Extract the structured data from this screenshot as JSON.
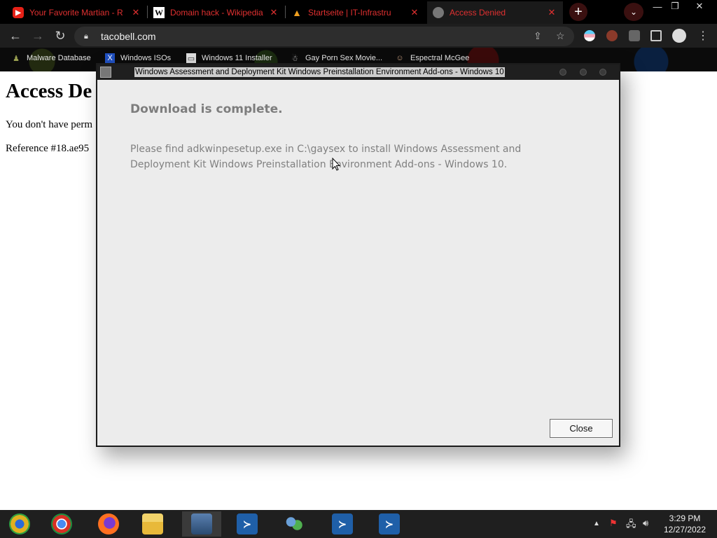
{
  "browser": {
    "tabs": [
      {
        "title": "Your Favorite Martian - R",
        "icon": "youtube-icon"
      },
      {
        "title": "Domain hack - Wikipedia",
        "icon": "wikipedia-icon"
      },
      {
        "title": "Startseite | IT-Infrastru",
        "icon": "warning-triangle-icon"
      },
      {
        "title": "Access Denied",
        "icon": "globe-icon",
        "active": true
      }
    ],
    "url": "tacobell.com",
    "bookmarks": [
      {
        "label": "Malware Database",
        "icon": "person-icon"
      },
      {
        "label": "Windows ISOs",
        "icon": "x-icon"
      },
      {
        "label": "Windows 11 Installer",
        "icon": "image-icon"
      },
      {
        "label": "Gay Porn Sex Movie...",
        "icon": "figure-icon"
      },
      {
        "label": "Espectral McGee",
        "icon": "face-icon"
      }
    ]
  },
  "page": {
    "heading": "Access De",
    "paragraph": "You don't have perm",
    "reference": "Reference #18.ae95"
  },
  "dialog": {
    "title": "Windows Assessment and Deployment Kit Windows Preinstallation Environment Add-ons - Windows 10",
    "heading": "Download is complete.",
    "message": "Please find adkwinpesetup.exe in C:\\gaysex to install Windows Assessment and Deployment Kit Windows Preinstallation Environment Add-ons - Windows 10.",
    "close_label": "Close"
  },
  "taskbar": {
    "apps": [
      "chrome-alt-icon",
      "chrome-icon",
      "firefox-icon",
      "file-explorer-icon",
      "network-installer-icon",
      "powershell-icon",
      "users-icon",
      "powershell-icon",
      "powershell-icon"
    ],
    "clock": {
      "time": "3:29 PM",
      "date": "12/27/2022"
    }
  },
  "colors": {
    "tab_text": "#e03030",
    "dialog_bg": "#ececec",
    "dialog_text": "#808080"
  }
}
